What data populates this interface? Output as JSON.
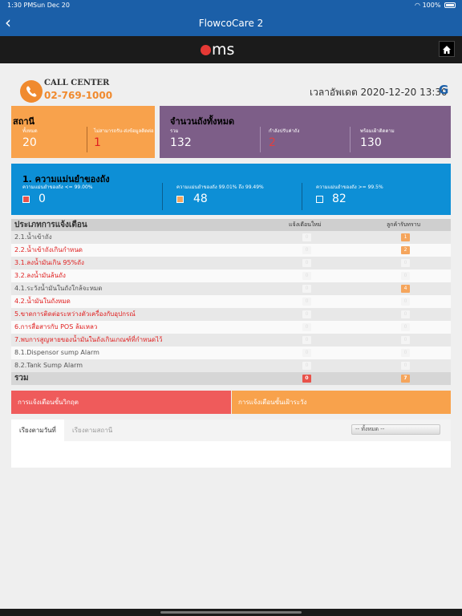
{
  "status_bar": {
    "time": "1:30 PM",
    "date": "Sun Dec 20",
    "battery": "100%"
  },
  "nav": {
    "back_icon": "chevron-left-icon",
    "title": "FlowcoCare 2"
  },
  "brand": {
    "logo_text": "ms",
    "home_icon": "home-icon"
  },
  "call_center": {
    "title": "CALL CENTER",
    "number": "02-769-1000",
    "phone_icon": "phone-icon"
  },
  "update": {
    "text": "เวลาอัพเดต 2020-12-20 13:30",
    "refresh_icon": "refresh-icon"
  },
  "stations": {
    "title": "สถานี",
    "total_label": "ทั้งหมด",
    "total_value": "20",
    "noconn_label": "ไม่สามารถรับ-ส่งข้อมูลติดต่อ",
    "noconn_value": "1",
    "color": "#f8a24c"
  },
  "tanks": {
    "title": "จำนวนถังทั้งหมด",
    "total_label": "รวม",
    "total_value": "132",
    "adjust_label": "กำลังปรับค่าถัง",
    "adjust_value": "2",
    "ready_label": "พร้อมเฝ้าติดตาม",
    "ready_value": "130",
    "color": "#7d5e88"
  },
  "accuracy": {
    "title": "1. ความแม่นยำของถัง",
    "low_label": "ความแม่นยำของถัง <= 99.00%",
    "low_value": "0",
    "mid_label": "ความแม่นยำของถัง 99.01% ถึง 99.49%",
    "mid_value": "48",
    "high_label": "ความแม่นยำของถัง >= 99.5%",
    "high_value": "82",
    "color": "#0d8fd6"
  },
  "alerts": {
    "header": "ประเภทการแจ้งเตือน",
    "col_new": "แจ้งเตือนใหม่",
    "col_ack": "ลูกค้ารับทราบ",
    "rows": [
      {
        "label": "2.1.น้ำเข้าถัง",
        "new": "0",
        "ack": "1"
      },
      {
        "label": "2.2.น้ำเข้าถังเกินกำหนด",
        "new": "0",
        "ack": "2"
      },
      {
        "label": "3.1.ลงน้ำมันเกิน 95%ถัง",
        "new": "0",
        "ack": "0"
      },
      {
        "label": "3.2.ลงน้ำมันล้นถัง",
        "new": "0",
        "ack": "0"
      },
      {
        "label": "4.1.ระวังน้ำมันในถังใกล้จะหมด",
        "new": "0",
        "ack": "4"
      },
      {
        "label": "4.2.น้ำมันในถังหมด",
        "new": "0",
        "ack": "0"
      },
      {
        "label": "5.ขาดการติดต่อระหว่างตัวเครื่องกับอุปกรณ์",
        "new": "0",
        "ack": "0"
      },
      {
        "label": "6.การสื่อสารกับ POS ล้มเหลว",
        "new": "0",
        "ack": "0"
      },
      {
        "label": "7.พบการสูญหายของน้ำมันในถังเกินเกณฑ์ที่กำหนดไว้",
        "new": "0",
        "ack": "0"
      },
      {
        "label": "8.1.Dispensor sump Alarm",
        "new": "0",
        "ack": "0"
      },
      {
        "label": "8.2.Tank Sump Alarm",
        "new": "0",
        "ack": "0"
      }
    ],
    "total_label": "รวม",
    "total_new": "0",
    "total_ack": "7"
  },
  "alert_buttons": {
    "critical": "การแจ้งเตือนขั้นวิกฤต",
    "warning": "การแจ้งเตือนขั้นเฝ้าระวัง"
  },
  "tabs": {
    "by_date": "เรียงตามวันที่",
    "by_station": "เรียงตามสถานี",
    "filter_value": "-- ทั้งหมด --"
  }
}
